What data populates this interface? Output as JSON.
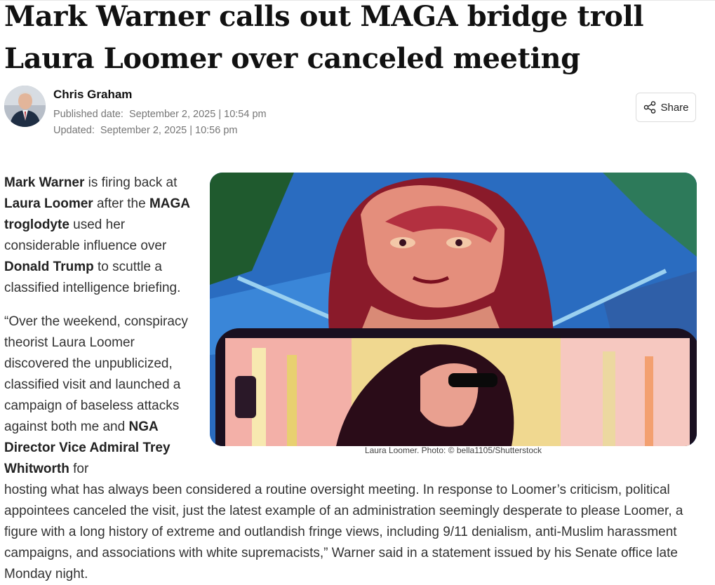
{
  "article": {
    "title": "Mark Warner calls out MAGA bridge troll Laura Loomer over canceled meeting"
  },
  "author": {
    "name": "Chris Graham",
    "published_label": "Published date:",
    "published_value": "September 2, 2025 | 10:54 pm",
    "updated_label": "Updated:",
    "updated_value": "September 2, 2025 | 10:56 pm"
  },
  "share": {
    "label": "Share",
    "icon": "share-icon"
  },
  "image": {
    "caption": "Laura Loomer. Photo: © bella1105/Shutterstock"
  },
  "body": {
    "p1": {
      "b1": "Mark Warner",
      "t1": " is firing back at ",
      "b2": "Laura Loomer",
      "t2": " after the ",
      "b3": "MAGA troglodyte",
      "t3": " used her considerable influence over ",
      "b4": "Donald Trump",
      "t4": " to scuttle a classified intelligence briefing."
    },
    "p2": {
      "t1": "“Over the weekend, conspiracy theorist Laura Loomer discovered the unpublicized, classified visit and launched a campaign of baseless attacks against both me and ",
      "b1": "NGA Director Vice Admiral Trey Whitworth",
      "t2": " for"
    },
    "p3": "hosting what has always been considered a routine oversight meeting. In response to Loomer’s criticism, political appointees canceled the visit, just the latest example of an administration seemingly desperate to please Loomer, a figure with a long history of extreme and outlandish fringe views, including 9/11 denialism, anti-Muslim harassment campaigns, and associations with white supremacists,” Warner said in a statement issued by his Senate office late Monday night."
  }
}
